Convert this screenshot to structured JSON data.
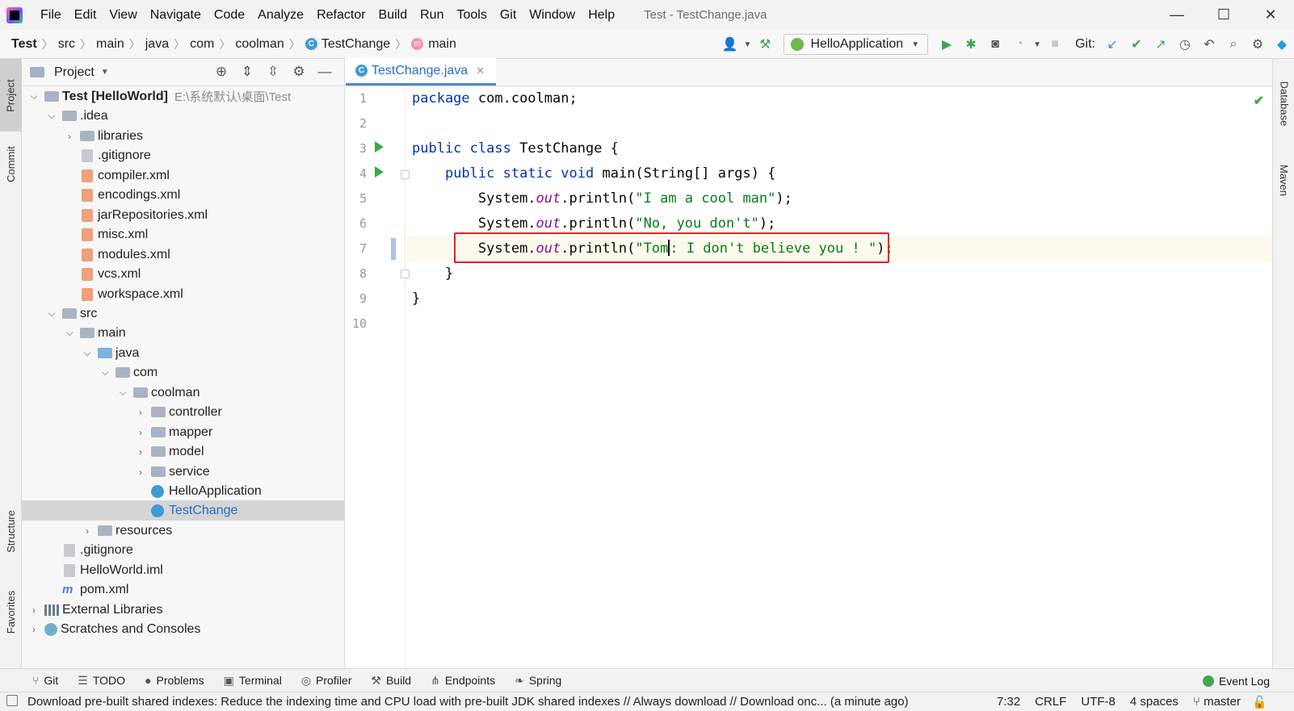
{
  "window": {
    "title": "Test - TestChange.java",
    "controls": [
      "—",
      "☐",
      "✕"
    ]
  },
  "menu": [
    "File",
    "Edit",
    "View",
    "Navigate",
    "Code",
    "Analyze",
    "Refactor",
    "Build",
    "Run",
    "Tools",
    "Git",
    "Window",
    "Help"
  ],
  "breadcrumb": [
    "Test",
    "src",
    "main",
    "java",
    "com",
    "coolman",
    "TestChange",
    "main"
  ],
  "toolbar": {
    "run_config": "HelloApplication",
    "git_label": "Git:"
  },
  "left_strip": [
    "Project",
    "Commit",
    "Structure",
    "Favorites"
  ],
  "right_strip": [
    "Database",
    "Maven"
  ],
  "project_panel": {
    "title": "Project",
    "tree": [
      {
        "label": "Test [HelloWorld]",
        "path": "E:\\系统默认\\桌面\\Test",
        "depth": 0,
        "chev": "v",
        "icon": "folder",
        "bold": true
      },
      {
        "label": ".idea",
        "depth": 1,
        "chev": "v",
        "icon": "folder"
      },
      {
        "label": "libraries",
        "depth": 2,
        "chev": ">",
        "icon": "folder"
      },
      {
        "label": ".gitignore",
        "depth": 2,
        "chev": "",
        "icon": "file"
      },
      {
        "label": "compiler.xml",
        "depth": 2,
        "chev": "",
        "icon": "xml"
      },
      {
        "label": "encodings.xml",
        "depth": 2,
        "chev": "",
        "icon": "xml"
      },
      {
        "label": "jarRepositories.xml",
        "depth": 2,
        "chev": "",
        "icon": "xml"
      },
      {
        "label": "misc.xml",
        "depth": 2,
        "chev": "",
        "icon": "xml"
      },
      {
        "label": "modules.xml",
        "depth": 2,
        "chev": "",
        "icon": "xml"
      },
      {
        "label": "vcs.xml",
        "depth": 2,
        "chev": "",
        "icon": "xml"
      },
      {
        "label": "workspace.xml",
        "depth": 2,
        "chev": "",
        "icon": "xml"
      },
      {
        "label": "src",
        "depth": 1,
        "chev": "v",
        "icon": "folder"
      },
      {
        "label": "main",
        "depth": 2,
        "chev": "v",
        "icon": "folder"
      },
      {
        "label": "java",
        "depth": 3,
        "chev": "v",
        "icon": "folder-src"
      },
      {
        "label": "com",
        "depth": 4,
        "chev": "v",
        "icon": "folder"
      },
      {
        "label": "coolman",
        "depth": 5,
        "chev": "v",
        "icon": "folder"
      },
      {
        "label": "controller",
        "depth": 6,
        "chev": ">",
        "icon": "folder"
      },
      {
        "label": "mapper",
        "depth": 6,
        "chev": ">",
        "icon": "folder"
      },
      {
        "label": "model",
        "depth": 6,
        "chev": ">",
        "icon": "folder"
      },
      {
        "label": "service",
        "depth": 6,
        "chev": ">",
        "icon": "folder"
      },
      {
        "label": "HelloApplication",
        "depth": 6,
        "chev": "",
        "icon": "class"
      },
      {
        "label": "TestChange",
        "depth": 6,
        "chev": "",
        "icon": "class",
        "selected": true
      },
      {
        "label": "resources",
        "depth": 3,
        "chev": ">",
        "icon": "folder"
      },
      {
        "label": ".gitignore",
        "depth": 1,
        "chev": "",
        "icon": "file"
      },
      {
        "label": "HelloWorld.iml",
        "depth": 1,
        "chev": "",
        "icon": "file"
      },
      {
        "label": "pom.xml",
        "depth": 1,
        "chev": "",
        "icon": "maven"
      },
      {
        "label": "External Libraries",
        "depth": 0,
        "chev": ">",
        "icon": "lib"
      },
      {
        "label": "Scratches and Consoles",
        "depth": 0,
        "chev": ">",
        "icon": "scratch"
      }
    ]
  },
  "editor": {
    "tab": "TestChange.java",
    "line_numbers": [
      "1",
      "2",
      "3",
      "4",
      "5",
      "6",
      "7",
      "8",
      "9",
      "10"
    ],
    "code": {
      "l1_kw": "package",
      "l1_rest": " com.coolman;",
      "l3_kw1": "public",
      "l3_kw2": "class",
      "l3_rest": " TestChange {",
      "l4_kw1": "public",
      "l4_kw2": "static",
      "l4_kw3": "void",
      "l4_rest": " main(String[] args) {",
      "println_prefix": "System.",
      "out": "out",
      "println_mid": ".println(",
      "l5_str": "\"I am a cool man\"",
      "l6_str": "\"No, you don't\"",
      "l7_str_a": "\"Tom",
      "l7_str_b": ": I don't believe you ! \"",
      "println_end": ");",
      "l8": "}",
      "l9": "}"
    }
  },
  "bottom_tools": [
    "Git",
    "TODO",
    "Problems",
    "Terminal",
    "Profiler",
    "Build",
    "Endpoints",
    "Spring"
  ],
  "event_log": "Event Log",
  "status": {
    "message": "Download pre-built shared indexes: Reduce the indexing time and CPU load with pre-built JDK shared indexes // Always download // Download onc... (a minute ago)",
    "position": "7:32",
    "line_sep": "CRLF",
    "encoding": "UTF-8",
    "indent": "4 spaces",
    "branch": "master"
  }
}
